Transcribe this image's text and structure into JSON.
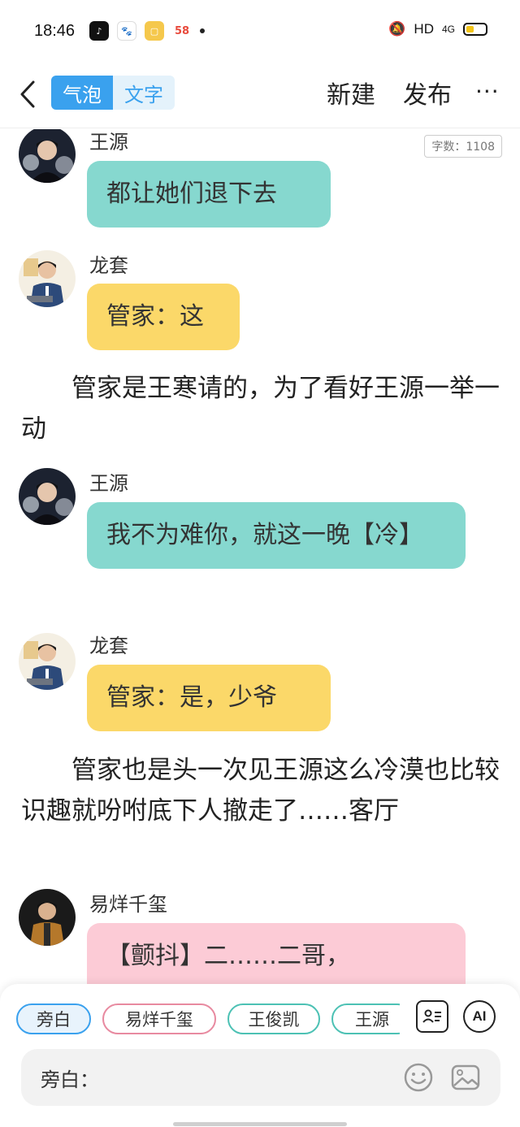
{
  "status_bar": {
    "time": "18:46",
    "network": "HD",
    "signal": "4G",
    "apps": [
      "tiktok-icon",
      "baidu-icon",
      "notes-icon",
      "58-icon"
    ],
    "app_58_label": "58"
  },
  "nav": {
    "mode_bubble": "气泡",
    "mode_text": "文字",
    "new_label": "新建",
    "publish_label": "发布",
    "more_label": "···"
  },
  "word_count": "字数：1108",
  "messages": [
    {
      "sender": "王源",
      "text": "都让她们退下去",
      "color": "teal"
    },
    {
      "sender": "龙套",
      "text": "管家：这",
      "color": "yellow"
    },
    {
      "narration": "管家是王寒请的，为了看好王源一举一动"
    },
    {
      "sender": "王源",
      "text": "我不为难你，就这一晚【冷】",
      "color": "teal"
    },
    {
      "sender": "龙套",
      "text": "管家：是，少爷",
      "color": "yellow"
    },
    {
      "narration": "管家也是头一次见王源这么冷漠也比较识趣就吩咐底下人撤走了……客厅"
    },
    {
      "sender": "易烊千玺",
      "text": "【颤抖】二……二哥，",
      "color": "pink"
    }
  ],
  "roles": [
    "旁白",
    "易烊千玺",
    "王俊凯",
    "王源"
  ],
  "tools": {
    "ai_label": "AI"
  },
  "input": {
    "label": "旁白：",
    "placeholder": ""
  },
  "colors": {
    "accent": "#3aa1ee",
    "teal": "#86d8cf",
    "yellow": "#fbd869",
    "pink": "#fccbd6"
  }
}
